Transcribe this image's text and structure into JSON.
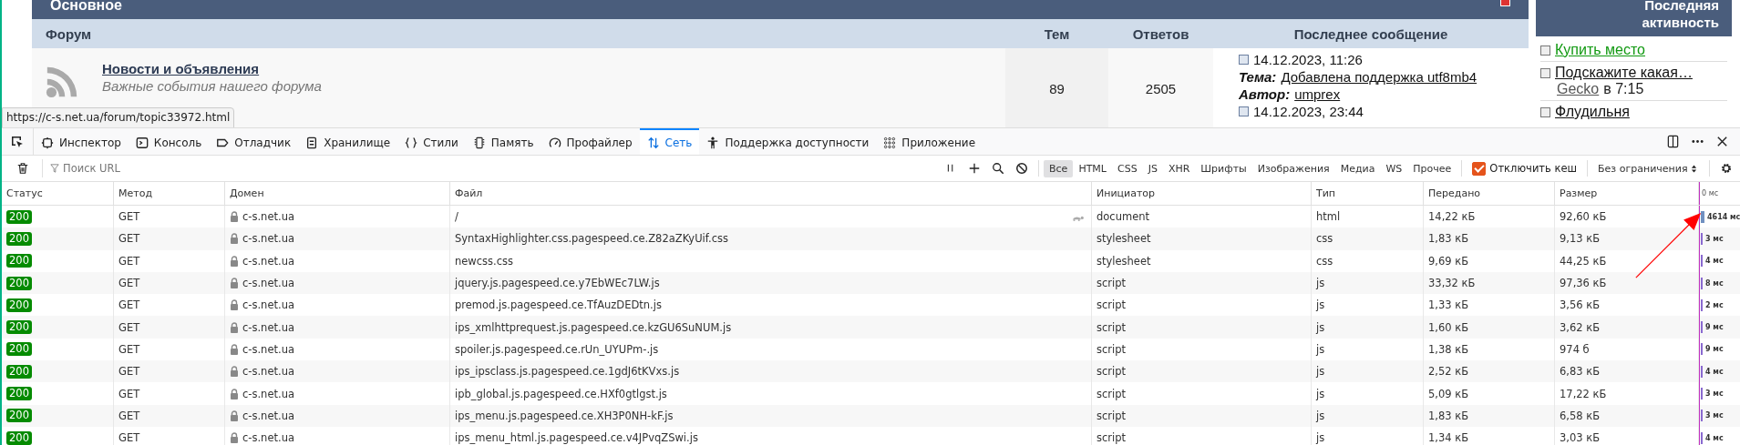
{
  "page": {
    "section_title": "Основное",
    "columns": [
      "Форум",
      "Тем",
      "Ответов",
      "Последнее сообщение"
    ],
    "forum": {
      "title": "Новости и объявления",
      "description": "Важные события нашего форума",
      "topics": "89",
      "replies": "2505",
      "last_post": {
        "date": "14.12.2023, 11:26",
        "topic_label": "Тема:",
        "topic": "Добавлена поддержка utf8mb4",
        "author_label": "Автор:",
        "author": "umprex",
        "next_date": "14.12.2023, 23:44"
      }
    },
    "sidebar": {
      "title": "Последняя активность",
      "items": [
        {
          "title": "Купить место",
          "color": "#119911"
        },
        {
          "title": "Подскажите какая…",
          "color": "#111111",
          "author": "Gecko",
          "time": "в 7:15"
        },
        {
          "title": "Флудильня",
          "color": "#111111"
        }
      ]
    }
  },
  "status_url": "https://c-s.net.ua/forum/topic33972.html",
  "devtools": {
    "tabs": [
      {
        "label": "Инспектор",
        "selected": false
      },
      {
        "label": "Консоль",
        "selected": false
      },
      {
        "label": "Отладчик",
        "selected": false
      },
      {
        "label": "Хранилище",
        "selected": false
      },
      {
        "label": "Стили",
        "selected": false
      },
      {
        "label": "Память",
        "selected": false
      },
      {
        "label": "Профайлер",
        "selected": false
      },
      {
        "label": "Сеть",
        "selected": true
      },
      {
        "label": "Поддержка доступности",
        "selected": false
      },
      {
        "label": "Приложение",
        "selected": false
      }
    ],
    "filter_placeholder": "Поиск URL",
    "type_filters": [
      {
        "label": "Все",
        "selected": true
      },
      {
        "label": "HTML",
        "selected": false
      },
      {
        "label": "CSS",
        "selected": false
      },
      {
        "label": "JS",
        "selected": false
      },
      {
        "label": "XHR",
        "selected": false
      },
      {
        "label": "Шрифты",
        "selected": false
      },
      {
        "label": "Изображения",
        "selected": false
      },
      {
        "label": "Медиа",
        "selected": false
      },
      {
        "label": "WS",
        "selected": false
      },
      {
        "label": "Прочее",
        "selected": false
      }
    ],
    "disable_cache": {
      "label": "Отключить кеш",
      "checked": true
    },
    "throttling": "Без ограничения",
    "columns": [
      "Статус",
      "Метод",
      "Домен",
      "Файл",
      "Инициатор",
      "Тип",
      "Передано",
      "Размер"
    ],
    "waterfall_label": "0 мс",
    "rows": [
      {
        "status": "200",
        "method": "GET",
        "domain": "c-s.net.ua",
        "file": "/",
        "initiator": "document",
        "type": "html",
        "transferred": "14,22 кБ",
        "size": "92,60 кБ",
        "time": "4614 мс",
        "slow": true
      },
      {
        "status": "200",
        "method": "GET",
        "domain": "c-s.net.ua",
        "file": "SyntaxHighlighter.css.pagespeed.ce.Z82aZKyUif.css",
        "initiator": "stylesheet",
        "type": "css",
        "transferred": "1,83 кБ",
        "size": "9,13 кБ",
        "time": "3 мс",
        "slow": false
      },
      {
        "status": "200",
        "method": "GET",
        "domain": "c-s.net.ua",
        "file": "newcss.css",
        "initiator": "stylesheet",
        "type": "css",
        "transferred": "9,69 кБ",
        "size": "44,25 кБ",
        "time": "4 мс",
        "slow": false
      },
      {
        "status": "200",
        "method": "GET",
        "domain": "c-s.net.ua",
        "file": "jquery.js.pagespeed.ce.y7EbWEc7LW.js",
        "initiator": "script",
        "type": "js",
        "transferred": "33,32 кБ",
        "size": "97,36 кБ",
        "time": "8 мс",
        "slow": false
      },
      {
        "status": "200",
        "method": "GET",
        "domain": "c-s.net.ua",
        "file": "premod.js.pagespeed.ce.TfAuzDEDtn.js",
        "initiator": "script",
        "type": "js",
        "transferred": "1,33 кБ",
        "size": "3,56 кБ",
        "time": "2 мс",
        "slow": false
      },
      {
        "status": "200",
        "method": "GET",
        "domain": "c-s.net.ua",
        "file": "ips_xmlhttprequest.js.pagespeed.ce.kzGU6SuNUM.js",
        "initiator": "script",
        "type": "js",
        "transferred": "1,60 кБ",
        "size": "3,62 кБ",
        "time": "9 мс",
        "slow": false
      },
      {
        "status": "200",
        "method": "GET",
        "domain": "c-s.net.ua",
        "file": "spoiler.js.pagespeed.ce.rUn_UYUPm-.js",
        "initiator": "script",
        "type": "js",
        "transferred": "1,38 кБ",
        "size": "974 б",
        "time": "9 мс",
        "slow": false
      },
      {
        "status": "200",
        "method": "GET",
        "domain": "c-s.net.ua",
        "file": "ips_ipsclass.js.pagespeed.ce.1gdJ6tKVxs.js",
        "initiator": "script",
        "type": "js",
        "transferred": "2,52 кБ",
        "size": "6,83 кБ",
        "time": "4 мс",
        "slow": false
      },
      {
        "status": "200",
        "method": "GET",
        "domain": "c-s.net.ua",
        "file": "ipb_global.js.pagespeed.ce.HXf0gtlgst.js",
        "initiator": "script",
        "type": "js",
        "transferred": "5,09 кБ",
        "size": "17,22 кБ",
        "time": "3 мс",
        "slow": false
      },
      {
        "status": "200",
        "method": "GET",
        "domain": "c-s.net.ua",
        "file": "ips_menu.js.pagespeed.ce.XH3P0NH-kF.js",
        "initiator": "script",
        "type": "js",
        "transferred": "1,83 кБ",
        "size": "6,58 кБ",
        "time": "3 мс",
        "slow": false
      },
      {
        "status": "200",
        "method": "GET",
        "domain": "c-s.net.ua",
        "file": "ips_menu_html.js.pagespeed.ce.v4JPvqZSwi.js",
        "initiator": "script",
        "type": "js",
        "transferred": "1,34 кБ",
        "size": "3,03 кБ",
        "time": "4 мс",
        "slow": false
      }
    ]
  }
}
